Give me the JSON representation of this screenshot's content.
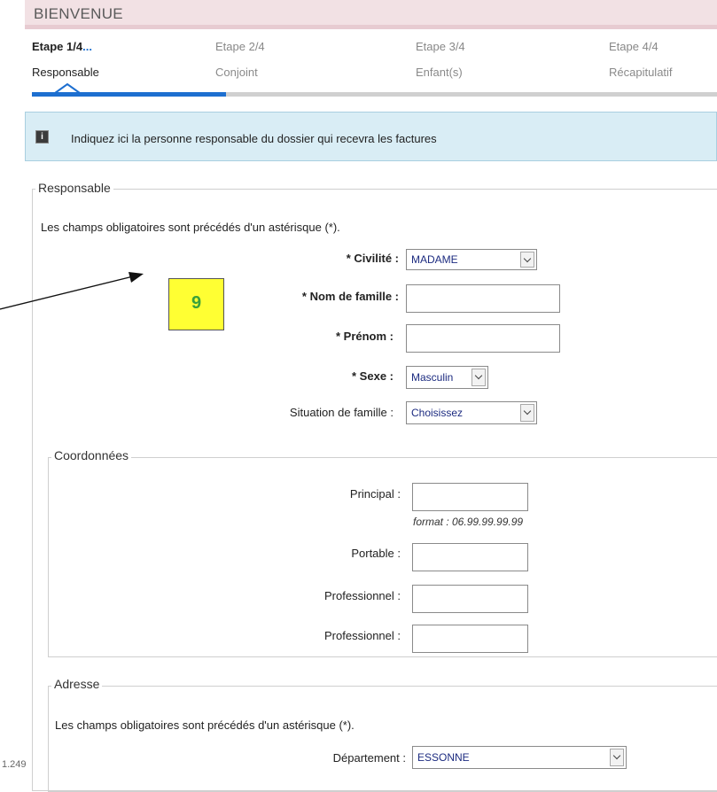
{
  "header": {
    "title": "BIENVENUE"
  },
  "steps": [
    {
      "title": "Etape 1/4",
      "dots": "...",
      "subtitle": "Responsable"
    },
    {
      "title": "Etape 2/4",
      "subtitle": "Conjoint"
    },
    {
      "title": "Etape 3/4",
      "subtitle": "Enfant(s)"
    },
    {
      "title": "Etape 4/4",
      "subtitle": "Récapitulatif"
    }
  ],
  "progress": {
    "current_step": 1,
    "total_steps": 4
  },
  "info": {
    "text": "Indiquez ici la personne responsable du dossier qui recevra les factures"
  },
  "responsable": {
    "legend": "Responsable",
    "required_note": "Les champs obligatoires sont précédés d'un astérisque (*).",
    "civilite_label": "* Civilité :",
    "civilite_value": "MADAME",
    "nom_label": "* Nom de famille :",
    "nom_value": "",
    "prenom_label": "* Prénom :",
    "prenom_value": "",
    "sexe_label": "* Sexe :",
    "sexe_value": "Masculin",
    "situation_label": "Situation de famille :",
    "situation_value": "Choisissez"
  },
  "coordonnees": {
    "legend": "Coordonnées",
    "principal_label": "Principal :",
    "principal_value": "",
    "format_hint": "format : 06.99.99.99.99",
    "portable_label": "Portable :",
    "portable_value": "",
    "pro1_label": "Professionnel :",
    "pro1_value": "",
    "pro2_label": "Professionnel :",
    "pro2_value": ""
  },
  "adresse": {
    "legend": "Adresse",
    "required_note": "Les champs obligatoires sont précédés d'un astérisque (*).",
    "departement_label": "Département :",
    "departement_value": "ESSONNE"
  },
  "annotation": {
    "label": "9"
  },
  "footer": {
    "version": "1.249"
  }
}
